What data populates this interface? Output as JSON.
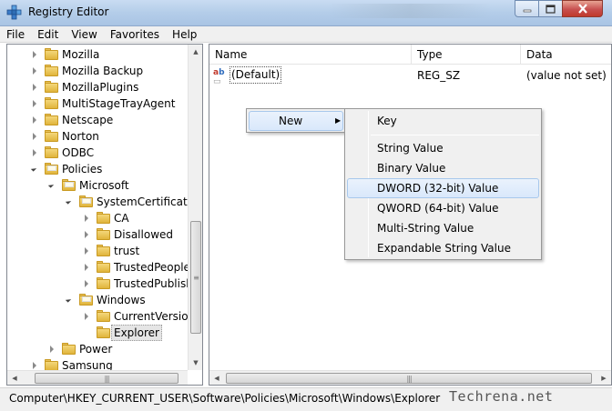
{
  "window": {
    "title": "Registry Editor"
  },
  "menu": [
    "File",
    "Edit",
    "View",
    "Favorites",
    "Help"
  ],
  "tree": [
    {
      "label": "Mozilla",
      "expanded": false
    },
    {
      "label": "Mozilla Backup",
      "expanded": false
    },
    {
      "label": "MozillaPlugins",
      "expanded": false
    },
    {
      "label": "MultiStageTrayAgent",
      "expanded": false
    },
    {
      "label": "Netscape",
      "expanded": false
    },
    {
      "label": "Norton",
      "expanded": false
    },
    {
      "label": "ODBC",
      "expanded": false
    },
    {
      "label": "Policies",
      "expanded": true
    },
    {
      "label": "Microsoft",
      "expanded": true
    },
    {
      "label": "SystemCertificates",
      "expanded": true
    },
    {
      "label": "CA",
      "expanded": false
    },
    {
      "label": "Disallowed",
      "expanded": false
    },
    {
      "label": "trust",
      "expanded": false
    },
    {
      "label": "TrustedPeople",
      "expanded": false
    },
    {
      "label": "TrustedPublish",
      "expanded": false
    },
    {
      "label": "Windows",
      "expanded": true
    },
    {
      "label": "CurrentVersion",
      "expanded": false
    },
    {
      "label": "Explorer",
      "selected": true
    },
    {
      "label": "Power",
      "expanded": false
    },
    {
      "label": "Samsung",
      "expanded": false
    }
  ],
  "list": {
    "columns": [
      "Name",
      "Type",
      "Data"
    ],
    "rows": [
      {
        "name": "(Default)",
        "type": "REG_SZ",
        "data": "(value not set)"
      }
    ]
  },
  "context_menu": {
    "new_label": "New",
    "submenu": {
      "key": "Key",
      "string": "String Value",
      "binary": "Binary Value",
      "dword": "DWORD (32-bit) Value",
      "qword": "QWORD (64-bit) Value",
      "multi": "Multi-String Value",
      "expandable": "Expandable String Value"
    }
  },
  "status": {
    "path": "Computer\\HKEY_CURRENT_USER\\Software\\Policies\\Microsoft\\Windows\\Explorer"
  },
  "watermark": "Techrena.net"
}
